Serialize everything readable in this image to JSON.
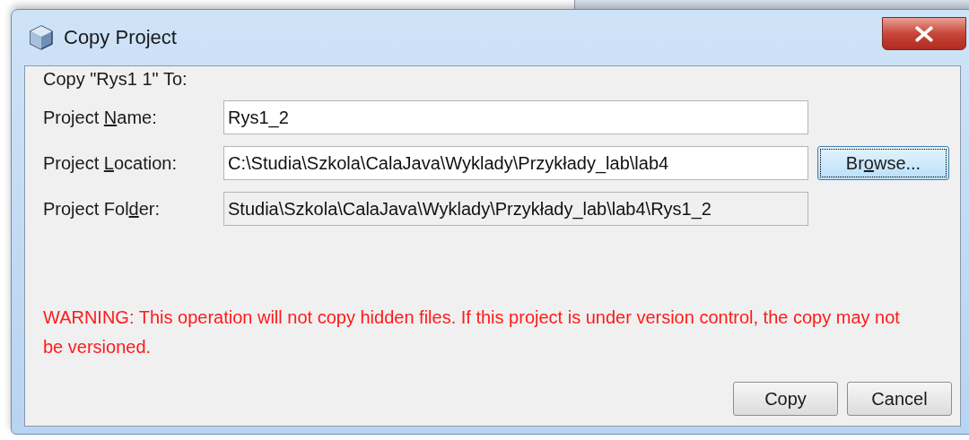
{
  "window": {
    "title": "Copy Project"
  },
  "heading": "Copy \"Rys1  1\" To:",
  "fields": [
    {
      "label": {
        "before": "Project ",
        "mnemonic": "N",
        "after": "ame:"
      },
      "value": "Rys1_2",
      "editable": true,
      "has_browse": false
    },
    {
      "label": {
        "before": "Project ",
        "mnemonic": "L",
        "after": "ocation:"
      },
      "value": "C:\\Studia\\Szkola\\CalaJava\\Wyklady\\Przykłady_lab\\lab4",
      "editable": true,
      "has_browse": true
    },
    {
      "label": {
        "before": "Project Fol",
        "mnemonic": "d",
        "after": "er:"
      },
      "value": "Studia\\Szkola\\CalaJava\\Wyklady\\Przykłady_lab\\lab4\\Rys1_2",
      "editable": false,
      "has_browse": false
    }
  ],
  "browse_button": {
    "before": "Br",
    "mnemonic": "o",
    "after": "wse...",
    "focused": true
  },
  "warning": "WARNING: This operation will not copy hidden files. If this project is under version control, the copy may not be versioned.",
  "buttons": [
    "Copy",
    "Cancel"
  ]
}
